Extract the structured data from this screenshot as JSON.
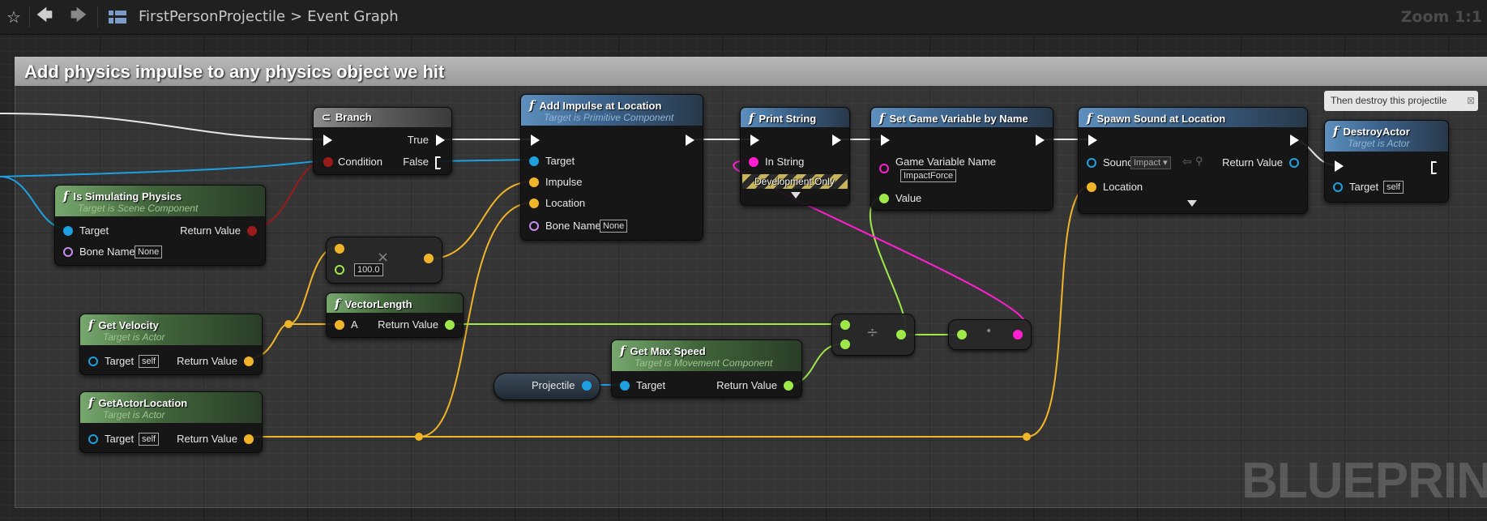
{
  "toolbar": {
    "breadcrumb_root": "FirstPersonProjectile",
    "breadcrumb_sep": ">",
    "breadcrumb_leaf": "Event Graph",
    "zoom": "Zoom 1:1"
  },
  "comment": {
    "title": "Add physics impulse to any physics object we hit"
  },
  "tooltip": "Then destroy this projectile",
  "watermark": "BLUEPRINT",
  "nodes": {
    "branch": {
      "title": "Branch",
      "true_label": "True",
      "false_label": "False",
      "condition": "Condition"
    },
    "is_simulating": {
      "title": "Is Simulating Physics",
      "subtitle": "Target is Scene Component",
      "target": "Target",
      "return": "Return Value",
      "bone": "Bone Name",
      "bone_value": "None"
    },
    "add_impulse": {
      "title": "Add Impulse at Location",
      "subtitle": "Target is Primitive Component",
      "target": "Target",
      "impulse": "Impulse",
      "location": "Location",
      "bone": "Bone Name",
      "bone_value": "None"
    },
    "print_string": {
      "title": "Print String",
      "in_string": "In String",
      "dev_only": "Development Only"
    },
    "set_game_var": {
      "title": "Set Game Variable by Name",
      "var_name": "Game Variable Name",
      "var_value": "ImpactForce",
      "value": "Value"
    },
    "spawn_sound": {
      "title": "Spawn Sound at Location",
      "sound": "Sound",
      "sound_value": "Impact",
      "return": "Return Value",
      "location": "Location"
    },
    "destroy_actor": {
      "title": "DestroyActor",
      "subtitle": "Target is Actor",
      "target": "Target",
      "target_value": "self"
    },
    "multiply": {
      "value": "100.0"
    },
    "vector_length": {
      "title": "VectorLength",
      "a": "A",
      "return": "Return Value"
    },
    "get_velocity": {
      "title": "Get Velocity",
      "subtitle": "Target is Actor",
      "target": "Target",
      "target_value": "self",
      "return": "Return Value"
    },
    "get_actor_location": {
      "title": "GetActorLocation",
      "subtitle": "Target is Actor",
      "target": "Target",
      "target_value": "self",
      "return": "Return Value"
    },
    "get_max_speed": {
      "title": "Get Max Speed",
      "subtitle": "Target is Movement Component",
      "target": "Target",
      "return": "Return Value"
    },
    "projectile": {
      "label": "Projectile"
    }
  },
  "colors": {
    "exec": "#ffffff",
    "bool": "#9b1a1a",
    "object": "#1ea0e0",
    "vector": "#f0b428",
    "float": "#9ee84a",
    "string": "#ff1fd0",
    "name": "#c88cf0"
  }
}
